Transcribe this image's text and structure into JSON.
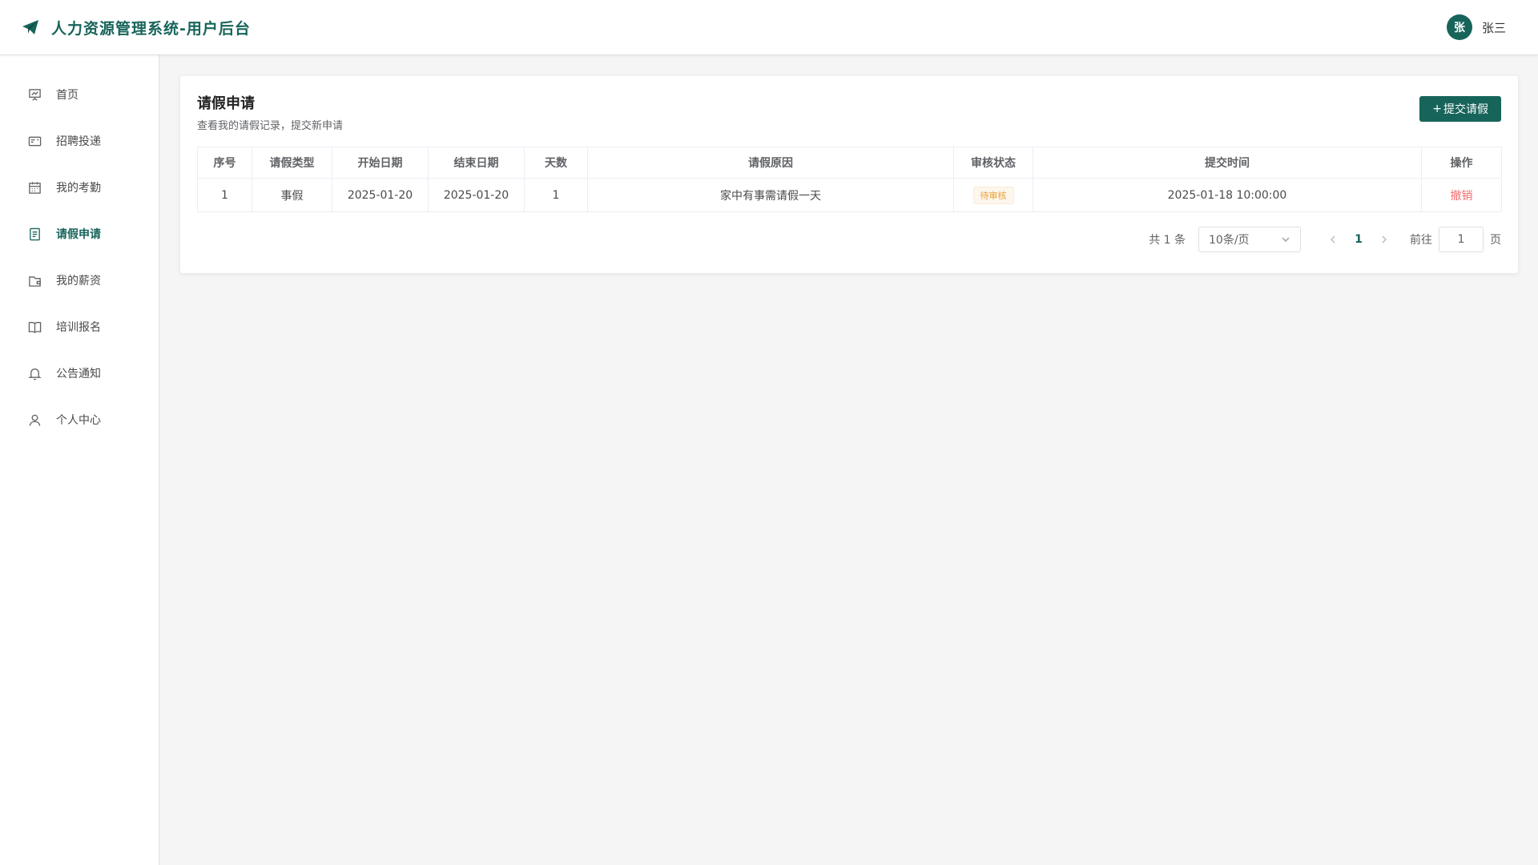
{
  "header": {
    "title": "人力资源管理系统-用户后台",
    "avatar_text": "张",
    "username": "张三"
  },
  "sidebar": {
    "items": [
      {
        "label": "首页",
        "icon": "presentation-chart-icon"
      },
      {
        "label": "招聘投递",
        "icon": "id-card-icon"
      },
      {
        "label": "我的考勤",
        "icon": "calendar-icon"
      },
      {
        "label": "请假申请",
        "icon": "document-icon",
        "active": true
      },
      {
        "label": "我的薪资",
        "icon": "wallet-icon"
      },
      {
        "label": "培训报名",
        "icon": "book-icon"
      },
      {
        "label": "公告通知",
        "icon": "bell-icon"
      },
      {
        "label": "个人中心",
        "icon": "user-icon"
      }
    ]
  },
  "page": {
    "title": "请假申请",
    "subtitle": "查看我的请假记录，提交新申请",
    "submit_label": "提交请假"
  },
  "table": {
    "columns": [
      "序号",
      "请假类型",
      "开始日期",
      "结束日期",
      "天数",
      "请假原因",
      "审核状态",
      "提交时间",
      "操作"
    ],
    "rows": [
      {
        "index": "1",
        "type": "事假",
        "start": "2025-01-20",
        "end": "2025-01-20",
        "days": "1",
        "reason": "家中有事需请假一天",
        "status": "待审核",
        "submitted": "2025-01-18 10:00:00",
        "action": "撤销"
      }
    ]
  },
  "pagination": {
    "total_text": "共 1 条",
    "page_size": "10条/页",
    "current_page": "1",
    "goto_label": "前往",
    "goto_value": "1",
    "page_unit": "页"
  },
  "colors": {
    "accent": "#17645a",
    "warning": "#e6a23c",
    "danger": "#f56c6c"
  }
}
